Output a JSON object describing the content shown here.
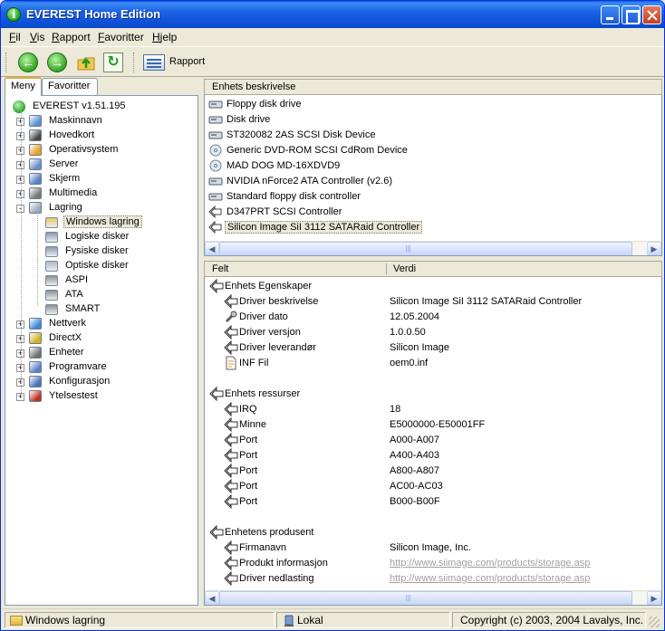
{
  "window": {
    "title": "EVEREST Home Edition"
  },
  "menubar": [
    {
      "label": "Fil",
      "u": "F",
      "rest": "il"
    },
    {
      "label": "Vis",
      "u": "V",
      "rest": "is"
    },
    {
      "label": "Rapport",
      "u": "R",
      "rest": "apport"
    },
    {
      "label": "Favoritter",
      "u": "F",
      "rest": "avoritter"
    },
    {
      "label": "Hjelp",
      "u": "H",
      "rest": "jelp"
    }
  ],
  "toolbar": {
    "report_label": "Rapport"
  },
  "tabs": {
    "menu": "Meny",
    "favorites": "Favoritter"
  },
  "tree": [
    {
      "label": "EVEREST v1.51.195",
      "level": 0,
      "icon": "info-icon",
      "color": "#2aa02a",
      "expander": ""
    },
    {
      "label": "Maskinnavn",
      "level": 1,
      "icon": "computer-icon",
      "color": "#5b8fd6",
      "expander": "+"
    },
    {
      "label": "Hovedkort",
      "level": 1,
      "icon": "motherboard-icon",
      "color": "#4a4a4a",
      "expander": "+"
    },
    {
      "label": "Operativsystem",
      "level": 1,
      "icon": "windows-logo-icon",
      "color": "#e8a020",
      "expander": "+"
    },
    {
      "label": "Server",
      "level": 1,
      "icon": "server-icon",
      "color": "#6c8ec8",
      "expander": "+"
    },
    {
      "label": "Skjerm",
      "level": 1,
      "icon": "monitor-icon",
      "color": "#5b7fc0",
      "expander": "+"
    },
    {
      "label": "Multimedia",
      "level": 1,
      "icon": "speaker-icon",
      "color": "#777777",
      "expander": "+"
    },
    {
      "label": "Lagring",
      "level": 1,
      "icon": "storage-icon",
      "color": "#9aa8b8",
      "expander": "-"
    },
    {
      "label": "Windows lagring",
      "level": 2,
      "icon": "folder-icon",
      "color": "#e8c860",
      "expander": "",
      "selected": true
    },
    {
      "label": "Logiske disker",
      "level": 2,
      "icon": "drive-icon",
      "color": "#8a9ab0",
      "expander": ""
    },
    {
      "label": "Fysiske disker",
      "level": 2,
      "icon": "disk-icon",
      "color": "#8a9ab0",
      "expander": ""
    },
    {
      "label": "Optiske disker",
      "level": 2,
      "icon": "cdrom-icon",
      "color": "#b0b8c8",
      "expander": ""
    },
    {
      "label": "ASPI",
      "level": 2,
      "icon": "aspi-icon",
      "color": "#909090",
      "expander": ""
    },
    {
      "label": "ATA",
      "level": 2,
      "icon": "ata-icon",
      "color": "#909090",
      "expander": ""
    },
    {
      "label": "SMART",
      "level": 2,
      "icon": "smart-icon",
      "color": "#909090",
      "expander": ""
    },
    {
      "label": "Nettverk",
      "level": 1,
      "icon": "network-globe-icon",
      "color": "#3a8ad8",
      "expander": "+"
    },
    {
      "label": "DirectX",
      "level": 1,
      "icon": "directx-icon",
      "color": "#d0b020",
      "expander": "+"
    },
    {
      "label": "Enheter",
      "level": 1,
      "icon": "devices-icon",
      "color": "#707070",
      "expander": "+"
    },
    {
      "label": "Programvare",
      "level": 1,
      "icon": "software-icon",
      "color": "#5a80c8",
      "expander": "+"
    },
    {
      "label": "Konfigurasjon",
      "level": 1,
      "icon": "config-icon",
      "color": "#4a70b8",
      "expander": "+"
    },
    {
      "label": "Ytelsestest",
      "level": 1,
      "icon": "benchmark-icon",
      "color": "#c03020",
      "expander": "+"
    }
  ],
  "devices": {
    "header": "Enhets beskrivelse",
    "items": [
      {
        "label": "Floppy disk drive",
        "icon": "floppy-icon"
      },
      {
        "label": "Disk drive",
        "icon": "disk-drive-icon"
      },
      {
        "label": "ST320082 2AS SCSI Disk Device",
        "icon": "disk-drive-icon"
      },
      {
        "label": "Generic DVD-ROM SCSI CdRom Device",
        "icon": "cdrom-icon"
      },
      {
        "label": "MAD DOG MD-16XDVD9",
        "icon": "cdrom-icon"
      },
      {
        "label": "NVIDIA nForce2 ATA Controller (v2.6)",
        "icon": "controller-icon"
      },
      {
        "label": "Standard floppy disk controller",
        "icon": "controller-icon"
      },
      {
        "label": "D347PRT SCSI Controller",
        "icon": "scsi-icon"
      },
      {
        "label": "Silicon Image SiI 3112 SATARaid Controller",
        "icon": "scsi-icon",
        "selected": true
      }
    ]
  },
  "props": {
    "col_field": "Felt",
    "col_value": "Verdi",
    "rows": [
      {
        "type": "group",
        "field": "Enhets Egenskaper",
        "value": ""
      },
      {
        "type": "item",
        "field": "Driver beskrivelse",
        "value": "Silicon Image SiI 3112 SATARaid Controller",
        "icon": "scsi-icon"
      },
      {
        "type": "item",
        "field": "Driver dato",
        "value": "12.05.2004",
        "icon": "tools-icon"
      },
      {
        "type": "item",
        "field": "Driver versjon",
        "value": "1.0.0.50",
        "icon": "scsi-icon"
      },
      {
        "type": "item",
        "field": "Driver leverandør",
        "value": "Silicon Image",
        "icon": "scsi-icon"
      },
      {
        "type": "item",
        "field": "INF Fil",
        "value": "oem0.inf",
        "icon": "inf-file-icon"
      },
      {
        "type": "blank"
      },
      {
        "type": "group",
        "field": "Enhets ressurser",
        "value": ""
      },
      {
        "type": "item",
        "field": "IRQ",
        "value": "18",
        "icon": "scsi-icon"
      },
      {
        "type": "item",
        "field": "Minne",
        "value": "E5000000-E50001FF",
        "icon": "scsi-icon"
      },
      {
        "type": "item",
        "field": "Port",
        "value": "A000-A007",
        "icon": "scsi-icon"
      },
      {
        "type": "item",
        "field": "Port",
        "value": "A400-A403",
        "icon": "scsi-icon"
      },
      {
        "type": "item",
        "field": "Port",
        "value": "A800-A807",
        "icon": "scsi-icon"
      },
      {
        "type": "item",
        "field": "Port",
        "value": "AC00-AC03",
        "icon": "scsi-icon"
      },
      {
        "type": "item",
        "field": "Port",
        "value": "B000-B00F",
        "icon": "scsi-icon"
      },
      {
        "type": "blank"
      },
      {
        "type": "group",
        "field": "Enhetens produsent",
        "value": ""
      },
      {
        "type": "item",
        "field": "Firmanavn",
        "value": "Silicon Image, Inc.",
        "icon": "scsi-icon"
      },
      {
        "type": "item",
        "field": "Produkt informasjon",
        "value": "http://www.siimage.com/products/storage.asp",
        "icon": "scsi-icon",
        "link": true
      },
      {
        "type": "item",
        "field": "Driver nedlasting",
        "value": "http://www.siimage.com/products/storage.asp",
        "icon": "scsi-icon",
        "link": true
      }
    ]
  },
  "status": {
    "section": "Windows lagring",
    "location": "Lokal",
    "copyright": "Copyright (c) 2003, 2004 Lavalys, Inc."
  }
}
